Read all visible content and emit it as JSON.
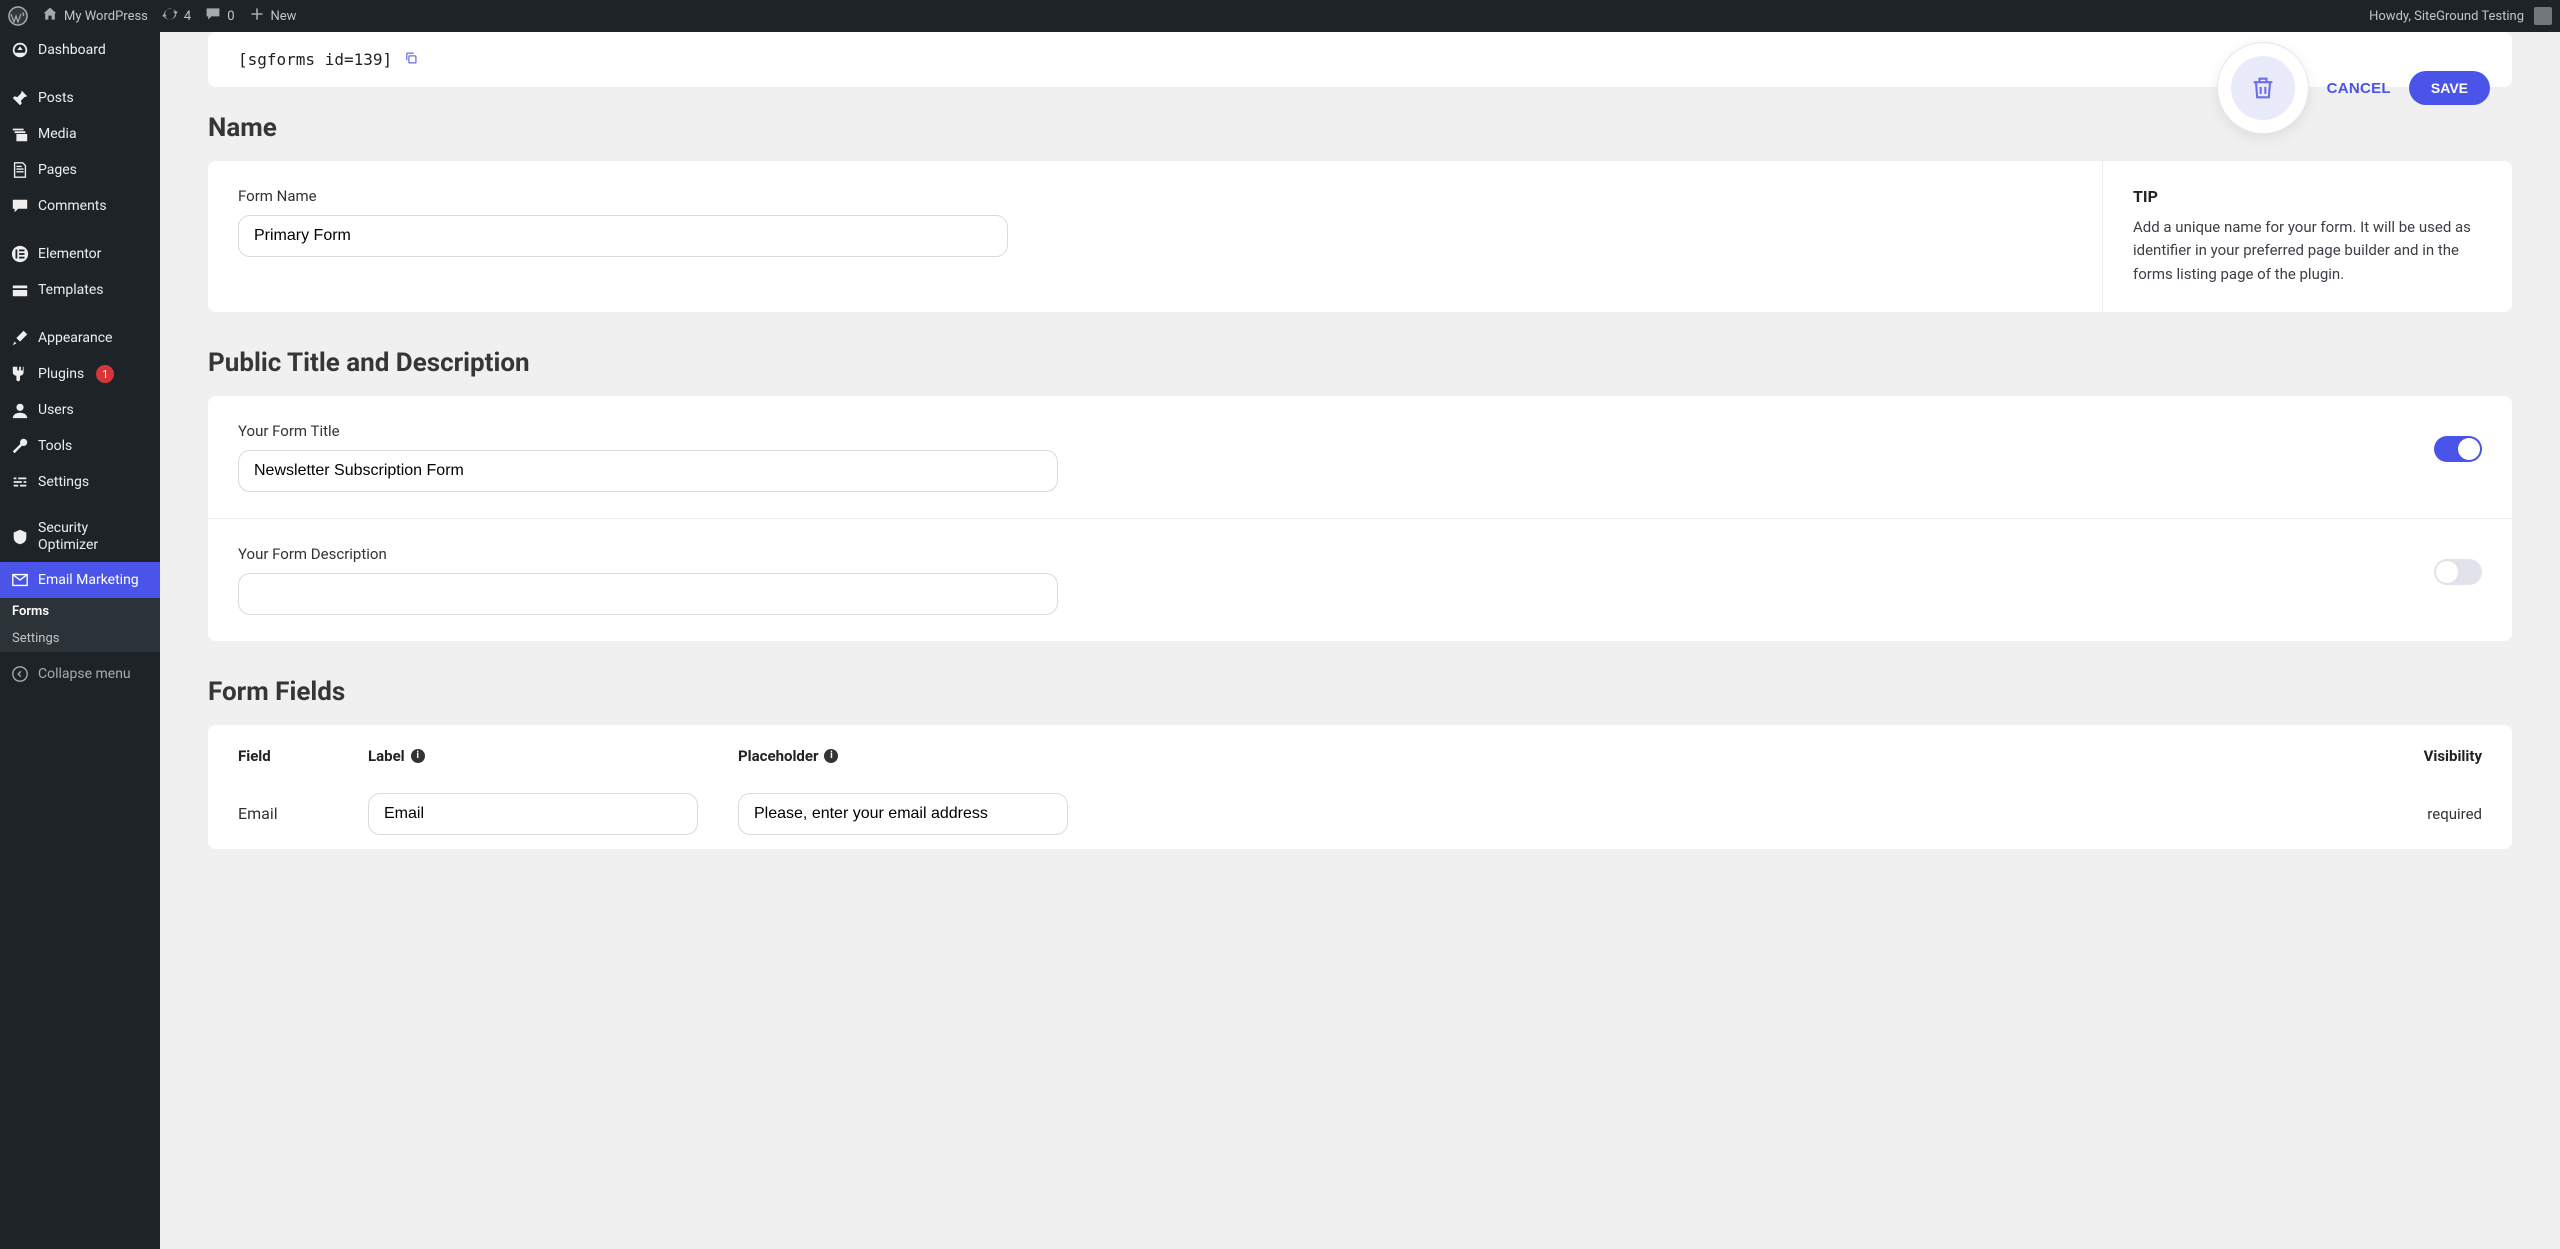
{
  "adminBar": {
    "siteName": "My WordPress",
    "updates": "4",
    "comments": "0",
    "newLabel": "New",
    "howdy": "Howdy, SiteGround Testing"
  },
  "sidebar": {
    "dashboard": "Dashboard",
    "posts": "Posts",
    "media": "Media",
    "pages": "Pages",
    "comments": "Comments",
    "elementor": "Elementor",
    "templates": "Templates",
    "appearance": "Appearance",
    "plugins": "Plugins",
    "pluginsBadge": "1",
    "users": "Users",
    "tools": "Tools",
    "settings": "Settings",
    "securityOptimizer": "Security Optimizer",
    "emailMarketing": "Email Marketing",
    "sub": {
      "forms": "Forms",
      "settings": "Settings"
    },
    "collapse": "Collapse menu"
  },
  "actions": {
    "cancel": "CANCEL",
    "save": "SAVE"
  },
  "shortcode": "[sgforms id=139]",
  "sections": {
    "name": {
      "title": "Name",
      "label": "Form Name",
      "value": "Primary Form",
      "tipTitle": "TIP",
      "tipBody": "Add a unique name for your form. It will be used as identifier in your preferred page builder and in the forms listing page of the plugin."
    },
    "publicTitle": {
      "title": "Public Title and Description",
      "titleLabel": "Your Form Title",
      "titleValue": "Newsletter Subscription Form",
      "descLabel": "Your Form Description",
      "descValue": ""
    },
    "formFields": {
      "title": "Form Fields",
      "headers": {
        "field": "Field",
        "label": "Label",
        "placeholder": "Placeholder",
        "visibility": "Visibility"
      },
      "rows": [
        {
          "field": "Email",
          "label": "Email",
          "placeholder": "Please, enter your email address",
          "visibility": "required"
        }
      ]
    }
  }
}
